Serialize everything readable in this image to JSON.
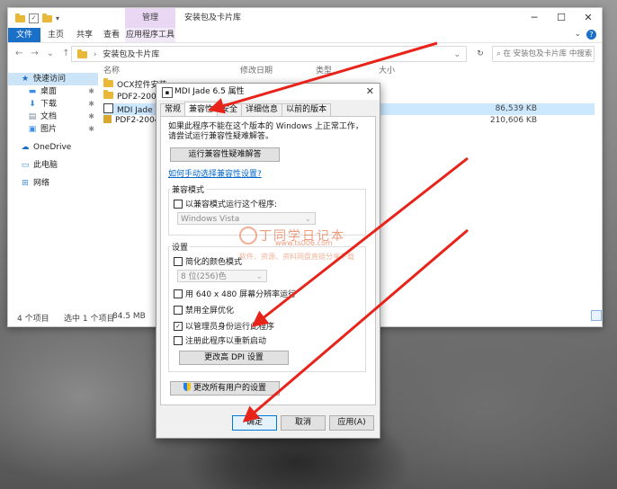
{
  "explorer": {
    "title": "安装包及卡片库",
    "manage_tab": "管理",
    "ribbon": {
      "file": "文件",
      "home": "主页",
      "share": "共享",
      "view": "查看",
      "app_tools": "应用程序工具"
    },
    "address": "安装包及卡片库",
    "search_placeholder": "在 安装包及卡片库 中搜索",
    "columns": {
      "name": "名称",
      "date": "修改日期",
      "type": "类型",
      "size": "大小"
    },
    "sidebar": [
      {
        "label": "快速访问",
        "icon": "star-icon"
      },
      {
        "label": "桌面",
        "icon": "desktop-icon",
        "pinned": true
      },
      {
        "label": "下载",
        "icon": "download-icon",
        "pinned": true
      },
      {
        "label": "文档",
        "icon": "document-icon",
        "pinned": true
      },
      {
        "label": "图片",
        "icon": "picture-icon",
        "pinned": true
      },
      {
        "label": "OneDrive",
        "icon": "cloud-icon"
      },
      {
        "label": "此电脑",
        "icon": "computer-icon"
      },
      {
        "label": "网络",
        "icon": "network-icon"
      }
    ],
    "files": [
      {
        "name": "OCX控件安装",
        "size": "",
        "icon": "folder-icon"
      },
      {
        "name": "PDF2-2004",
        "size": "",
        "icon": "folder-icon"
      },
      {
        "name": "MDI Jade 6.5",
        "size": "86,539 KB",
        "icon": "app-icon"
      },
      {
        "name": "PDF2-2004",
        "size": "210,606 KB",
        "icon": "installer-icon"
      }
    ],
    "status": {
      "count": "4 个项目",
      "selected": "选中 1 个项目",
      "size": "84.5 MB"
    }
  },
  "dialog": {
    "title": "MDI Jade 6.5 属性",
    "tabs": [
      "常规",
      "兼容性",
      "安全",
      "详细信息",
      "以前的版本"
    ],
    "active_tab": 1,
    "intro": "如果此程序不能在这个版本的 Windows 上正常工作，请尝试运行兼容性疑难解答。",
    "run_troubleshooter": "运行兼容性疑难解答",
    "manual_link": "如何手动选择兼容性设置?",
    "compat_mode": {
      "group_label": "兼容模式",
      "checkbox": "以兼容模式运行这个程序:",
      "os_value": "Windows Vista"
    },
    "settings": {
      "group_label": "设置",
      "reduced_color": "简化的颜色模式",
      "color_value": "8 位(256)色",
      "res_640": "用 640 x 480 屏幕分辨率运行",
      "disable_fullscreen": "禁用全屏优化",
      "run_as_admin": "以管理员身份运行此程序",
      "register_restart": "注册此程序以重新启动",
      "change_dpi": "更改高 DPI 设置",
      "admin_checked": true
    },
    "all_users_button": "更改所有用户的设置",
    "ok": "确定",
    "cancel": "取消",
    "apply": "应用(A)"
  },
  "watermark": {
    "title": "丁同学日记本",
    "url": "www.ts006.com",
    "tagline": "软件、资源、资料网盘直链分享下载"
  },
  "colors": {
    "accent": "#1a6fc9",
    "arrow": "#e8231a",
    "manage_tab": "#e9d7f4"
  }
}
